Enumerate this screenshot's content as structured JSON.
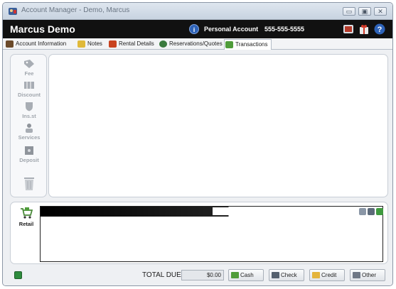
{
  "window": {
    "title": "Account Manager - Demo, Marcus",
    "controls": {
      "minimize": "▭",
      "maximize": "▣",
      "close": "✕"
    }
  },
  "header": {
    "account_name": "Marcus Demo",
    "account_type": "Personal Account",
    "phone": "555-555-5555"
  },
  "tabs": [
    {
      "label": "Account Information",
      "icon": "person-icon",
      "color": "#6b4a2a"
    },
    {
      "label": "Notes",
      "icon": "pencil-icon",
      "color": "#e0b93a"
    },
    {
      "label": "Rental Details",
      "icon": "document-icon",
      "color": "#c9431f"
    },
    {
      "label": "Reservations/Quotes",
      "icon": "globe-icon",
      "color": "#3a7a3e"
    },
    {
      "label": "Transactions",
      "icon": "money-icon",
      "color": "#4f9c3a",
      "active": true
    }
  ],
  "tools": [
    {
      "label": "Fee",
      "icon": "tag-icon"
    },
    {
      "label": "Discount",
      "icon": "ticket-icon"
    },
    {
      "label": "Ins.st",
      "icon": "shield-icon"
    },
    {
      "label": "Services",
      "icon": "person-icon"
    },
    {
      "label": "Deposit",
      "icon": "safe-icon"
    },
    {
      "label": "",
      "icon": "trash-icon"
    }
  ],
  "retail": {
    "label": "Retail",
    "search_value": ""
  },
  "footer": {
    "total_label": "TOTAL DUE",
    "total_value": "$0.00",
    "payments": [
      {
        "label": "Cash",
        "icon": "cash-icon"
      },
      {
        "label": "Check",
        "icon": "check-icon"
      },
      {
        "label": "Credit",
        "icon": "credit-card-icon"
      },
      {
        "label": "Other",
        "icon": "other-payment-icon"
      }
    ]
  }
}
